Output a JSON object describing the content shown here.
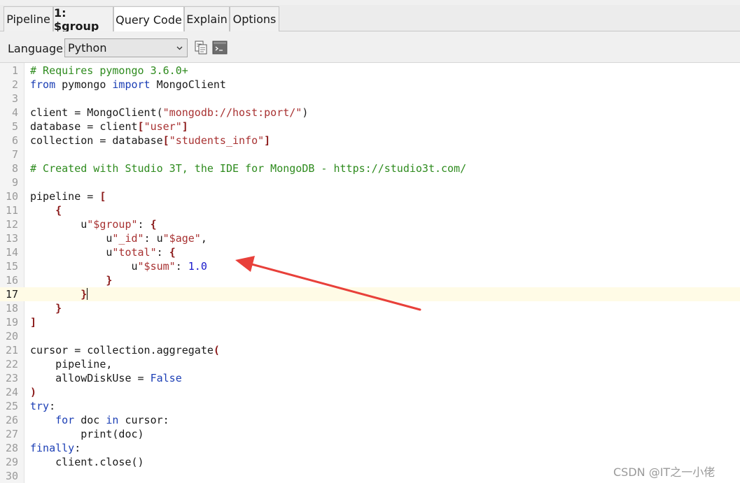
{
  "tabs": [
    {
      "label": "Pipeline",
      "bold": false,
      "active": false
    },
    {
      "label": "1: $group",
      "bold": true,
      "active": false
    },
    {
      "label": "Query Code",
      "bold": false,
      "active": true
    },
    {
      "label": "Explain",
      "bold": false,
      "active": false
    },
    {
      "label": "Options",
      "bold": false,
      "active": false
    }
  ],
  "toolbar": {
    "language_label": "Language:",
    "language_value": "Python",
    "icons": [
      "copy-icon",
      "terminal-icon"
    ]
  },
  "editor": {
    "current_line": 17,
    "lines": [
      {
        "n": "1",
        "tokens": [
          [
            "c",
            "# Requires pymongo 3.6.0+"
          ]
        ]
      },
      {
        "n": "2",
        "tokens": [
          [
            "k",
            "from"
          ],
          [
            "p",
            " pymongo "
          ],
          [
            "k",
            "import"
          ],
          [
            "p",
            " MongoClient"
          ]
        ]
      },
      {
        "n": "3",
        "tokens": []
      },
      {
        "n": "4",
        "tokens": [
          [
            "p",
            "client = MongoClient("
          ],
          [
            "s",
            "\"mongodb://host:port/\""
          ],
          [
            "p",
            ")"
          ]
        ]
      },
      {
        "n": "5",
        "tokens": [
          [
            "p",
            "database = client"
          ],
          [
            "b",
            "["
          ],
          [
            "s",
            "\"user\""
          ],
          [
            "b",
            "]"
          ]
        ]
      },
      {
        "n": "6",
        "tokens": [
          [
            "p",
            "collection = database"
          ],
          [
            "b",
            "["
          ],
          [
            "s",
            "\"students_info\""
          ],
          [
            "b",
            "]"
          ]
        ]
      },
      {
        "n": "7",
        "tokens": []
      },
      {
        "n": "8",
        "tokens": [
          [
            "c",
            "# Created with Studio 3T, the IDE for MongoDB - https://studio3t.com/"
          ]
        ]
      },
      {
        "n": "9",
        "tokens": []
      },
      {
        "n": "10",
        "tokens": [
          [
            "p",
            "pipeline = "
          ],
          [
            "b",
            "["
          ]
        ]
      },
      {
        "n": "11",
        "tokens": [
          [
            "p",
            "    "
          ],
          [
            "b",
            "{"
          ]
        ]
      },
      {
        "n": "12",
        "tokens": [
          [
            "p",
            "        u"
          ],
          [
            "s",
            "\"$group\""
          ],
          [
            "p",
            ": "
          ],
          [
            "b",
            "{"
          ]
        ]
      },
      {
        "n": "13",
        "tokens": [
          [
            "p",
            "            u"
          ],
          [
            "s",
            "\"_id\""
          ],
          [
            "p",
            ": u"
          ],
          [
            "s",
            "\"$age\""
          ],
          [
            "p",
            ","
          ]
        ]
      },
      {
        "n": "14",
        "tokens": [
          [
            "p",
            "            u"
          ],
          [
            "s",
            "\"total\""
          ],
          [
            "p",
            ": "
          ],
          [
            "b",
            "{"
          ]
        ]
      },
      {
        "n": "15",
        "tokens": [
          [
            "p",
            "                u"
          ],
          [
            "s",
            "\"$sum\""
          ],
          [
            "p",
            ": "
          ],
          [
            "n",
            "1.0"
          ]
        ]
      },
      {
        "n": "16",
        "tokens": [
          [
            "p",
            "            "
          ],
          [
            "b",
            "}"
          ]
        ]
      },
      {
        "n": "17",
        "tokens": [
          [
            "p",
            "        "
          ],
          [
            "b",
            "}"
          ]
        ],
        "cursor": true
      },
      {
        "n": "18",
        "tokens": [
          [
            "p",
            "    "
          ],
          [
            "b",
            "}"
          ]
        ]
      },
      {
        "n": "19",
        "tokens": [
          [
            "b",
            "]"
          ]
        ]
      },
      {
        "n": "20",
        "tokens": []
      },
      {
        "n": "21",
        "tokens": [
          [
            "p",
            "cursor = collection.aggregate"
          ],
          [
            "b",
            "("
          ]
        ]
      },
      {
        "n": "22",
        "tokens": [
          [
            "p",
            "    pipeline,"
          ]
        ]
      },
      {
        "n": "23",
        "tokens": [
          [
            "p",
            "    allowDiskUse = "
          ],
          [
            "k",
            "False"
          ]
        ]
      },
      {
        "n": "24",
        "tokens": [
          [
            "b",
            ")"
          ]
        ]
      },
      {
        "n": "25",
        "tokens": [
          [
            "k",
            "try"
          ],
          [
            "p",
            ":"
          ]
        ]
      },
      {
        "n": "26",
        "tokens": [
          [
            "p",
            "    "
          ],
          [
            "k",
            "for"
          ],
          [
            "p",
            " doc "
          ],
          [
            "k",
            "in"
          ],
          [
            "p",
            " cursor:"
          ]
        ]
      },
      {
        "n": "27",
        "tokens": [
          [
            "p",
            "        print(doc)"
          ]
        ]
      },
      {
        "n": "28",
        "tokens": [
          [
            "k",
            "finally"
          ],
          [
            "p",
            ":"
          ]
        ]
      },
      {
        "n": "29",
        "tokens": [
          [
            "p",
            "    client.close()"
          ]
        ]
      },
      {
        "n": "30",
        "tokens": []
      }
    ]
  },
  "annotation": {
    "color": "#e8403a"
  },
  "watermark": "CSDN @IT之一小佬"
}
